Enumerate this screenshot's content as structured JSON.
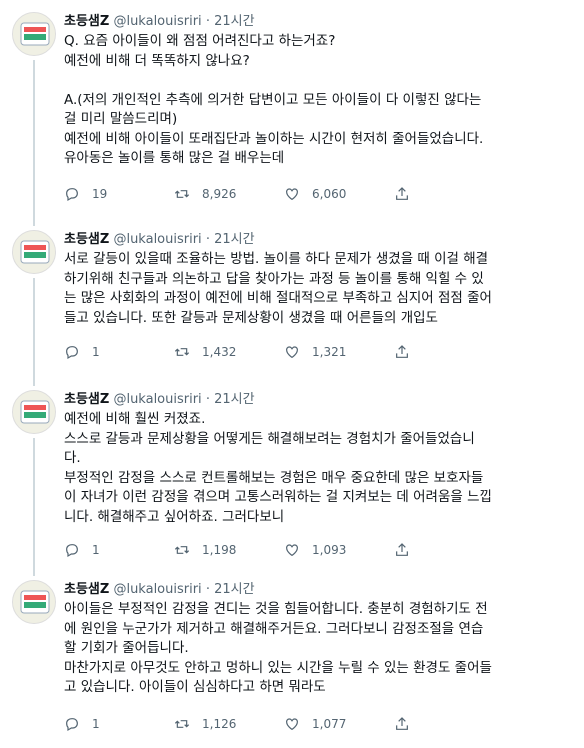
{
  "tweets": [
    {
      "name": "초등샘Z",
      "handle": "@lukalouisriri",
      "time": "· 21시간",
      "lines": [
        "Q. 요즘 아이들이 왜 점점 어려진다고 하는거죠?",
        "예전에 비해 더 똑똑하지 않나요?",
        "",
        "A.(저의 개인적인 추측에 의거한 답변이고 모든 아이들이 다 이렇진 않다는",
        "걸 미리 말씀드리며)",
        "예전에 비해 아이들이 또래집단과 놀이하는 시간이 현저히 줄어들었습니다.",
        "유아동은 놀이를 통해 많은 걸 배우는데"
      ],
      "replies": "19",
      "retweets": "8,926",
      "likes": "6,060"
    },
    {
      "name": "초등샘Z",
      "handle": "@lukalouisriri",
      "time": "· 21시간",
      "lines": [
        "서로 갈등이 있을때 조율하는 방법. 놀이를 하다 문제가 생겼을 때 이걸 해결",
        "하기위해 친구들과 의논하고 답을 찾아가는 과정 등 놀이를 통해 익힐 수 있",
        "는 많은 사회화의 과정이 예전에 비해 절대적으로 부족하고 심지어 점점 줄어",
        "들고 있습니다. 또한 갈등과 문제상황이 생겼을 때 어른들의 개입도"
      ],
      "replies": "1",
      "retweets": "1,432",
      "likes": "1,321"
    },
    {
      "name": "초등샘Z",
      "handle": "@lukalouisriri",
      "time": "· 21시간",
      "lines": [
        "예전에 비해 훨씬 커졌죠.",
        "스스로 갈등과 문제상황을 어떻게든 해결해보려는 경험치가 줄어들었습니",
        "다.",
        "부정적인 감정을 스스로 컨트롤해보는 경험은 매우 중요한데 많은 보호자들",
        "이 자녀가 이런 감정을 겪으며 고통스러워하는 걸 지켜보는 데 어려움을 느낍",
        "니다. 해결해주고 싶어하죠. 그러다보니"
      ],
      "replies": "1",
      "retweets": "1,198",
      "likes": "1,093"
    },
    {
      "name": "초등샘Z",
      "handle": "@lukalouisriri",
      "time": "· 21시간",
      "lines": [
        "아이들은 부정적인 감정을 견디는 것을 힘들어합니다. 충분히 경험하기도 전",
        "에 원인을 누군가가 제거하고 해결해주거든요. 그러다보니 감정조절을 연습",
        "할 기회가 줄어듭니다.",
        "마찬가지로 아무것도 안하고 멍하니 있는 시간을 누릴 수 있는 환경도 줄어들",
        "고 있습니다. 아이들이 심심하다고 하면 뭐라도"
      ],
      "replies": "1",
      "retweets": "1,126",
      "likes": "1,077"
    }
  ]
}
